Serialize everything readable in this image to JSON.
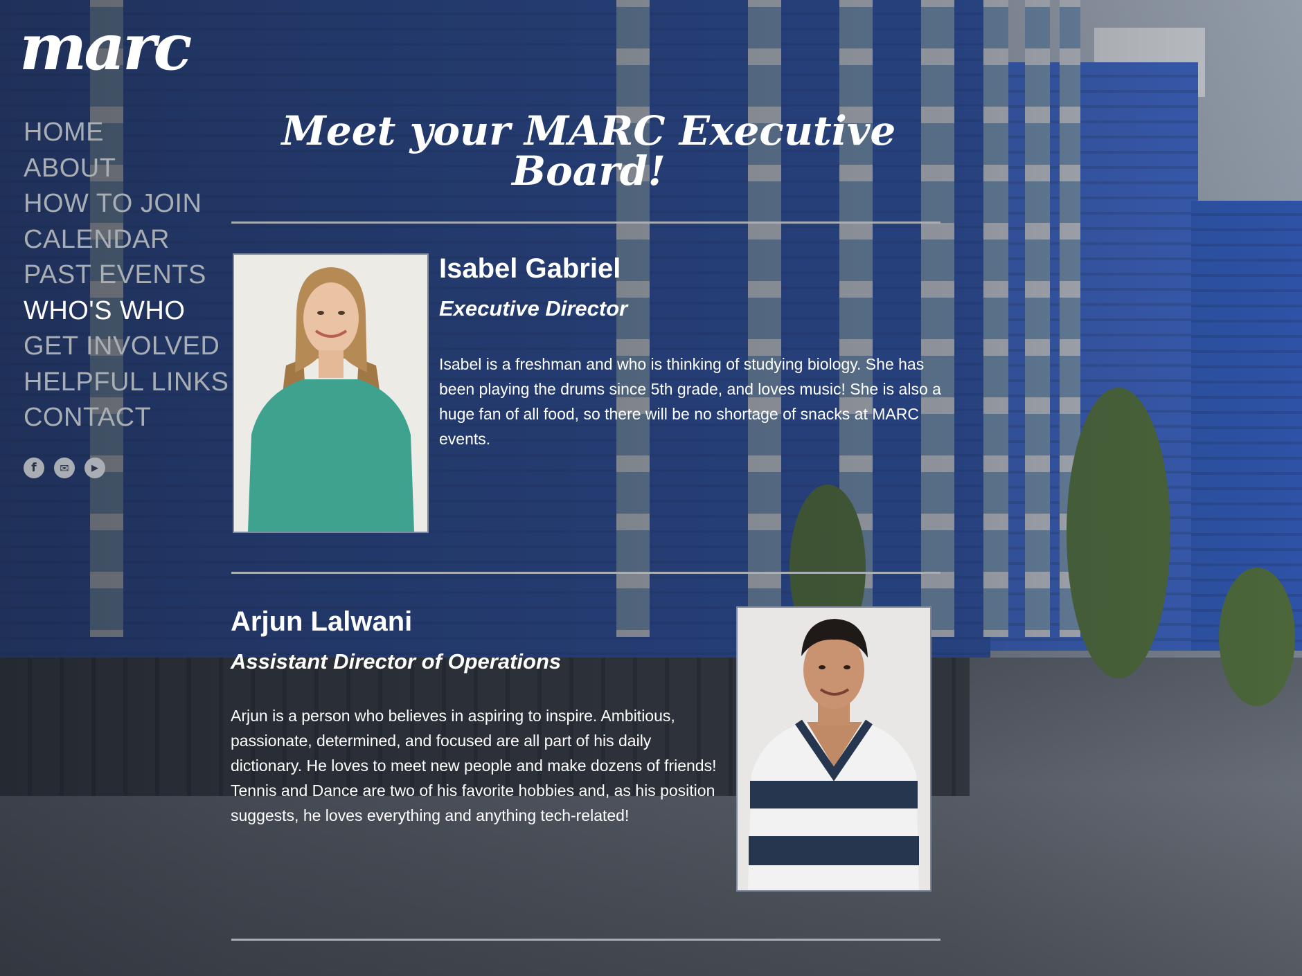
{
  "brand": {
    "logo_text": "marc"
  },
  "nav": {
    "items": [
      {
        "label": "HOME",
        "active": false
      },
      {
        "label": "ABOUT",
        "active": false
      },
      {
        "label": "HOW TO JOIN",
        "active": false
      },
      {
        "label": "CALENDAR",
        "active": false
      },
      {
        "label": "PAST EVENTS",
        "active": false
      },
      {
        "label": "WHO'S WHO",
        "active": true
      },
      {
        "label": "GET INVOLVED",
        "active": false
      },
      {
        "label": "HELPFUL LINKS",
        "active": false
      },
      {
        "label": "CONTACT",
        "active": false
      }
    ]
  },
  "social": {
    "facebook_glyph": "f",
    "email_glyph": "✉",
    "youtube_glyph": "▶"
  },
  "icons": {
    "facebook": "facebook-icon",
    "email": "email-icon",
    "youtube": "youtube-icon"
  },
  "page": {
    "title": "Meet your MARC Executive Board!"
  },
  "members": [
    {
      "name": "Isabel Gabriel",
      "role": "Executive Director",
      "bio": "Isabel is a freshman and who is thinking of studying biology. She has been playing the drums since 5th grade, and loves music! She is also a huge fan of all food, so there will be no shortage of snacks at MARC events."
    },
    {
      "name": "Arjun Lalwani",
      "role": "Assistant Director of Operations",
      "bio": "Arjun is a person who believes in aspiring to inspire. Ambitious, passionate, determined, and focused are all part of his daily dictionary. He loves to meet new people and make dozens of friends! Tennis and Dance are two of his favorite hobbies and, as his position suggests, he loves everything and anything tech-related!"
    }
  ],
  "colors": {
    "nav_inactive": "#a9adb4",
    "nav_active": "#ffffff",
    "divider": "#a9adb4",
    "building_blue": "#2d4f9c"
  }
}
